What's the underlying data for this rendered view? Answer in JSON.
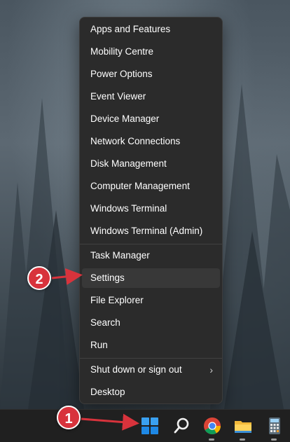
{
  "menu": {
    "items": [
      {
        "label": "Apps and Features"
      },
      {
        "label": "Mobility Centre"
      },
      {
        "label": "Power Options"
      },
      {
        "label": "Event Viewer"
      },
      {
        "label": "Device Manager"
      },
      {
        "label": "Network Connections"
      },
      {
        "label": "Disk Management"
      },
      {
        "label": "Computer Management"
      },
      {
        "label": "Windows Terminal"
      },
      {
        "label": "Windows Terminal (Admin)"
      },
      {
        "label": "Task Manager"
      },
      {
        "label": "Settings",
        "highlighted": true
      },
      {
        "label": "File Explorer"
      },
      {
        "label": "Search"
      },
      {
        "label": "Run"
      },
      {
        "label": "Shut down or sign out",
        "submenu_icon": "chevron-right-icon"
      },
      {
        "label": "Desktop"
      }
    ]
  },
  "taskbar": {
    "icons": [
      "windows-start-icon",
      "search-icon",
      "chrome-icon",
      "file-explorer-icon",
      "calculator-icon"
    ]
  },
  "annotations": {
    "marker_1": "1",
    "marker_2": "2",
    "color": "#d8333c"
  }
}
